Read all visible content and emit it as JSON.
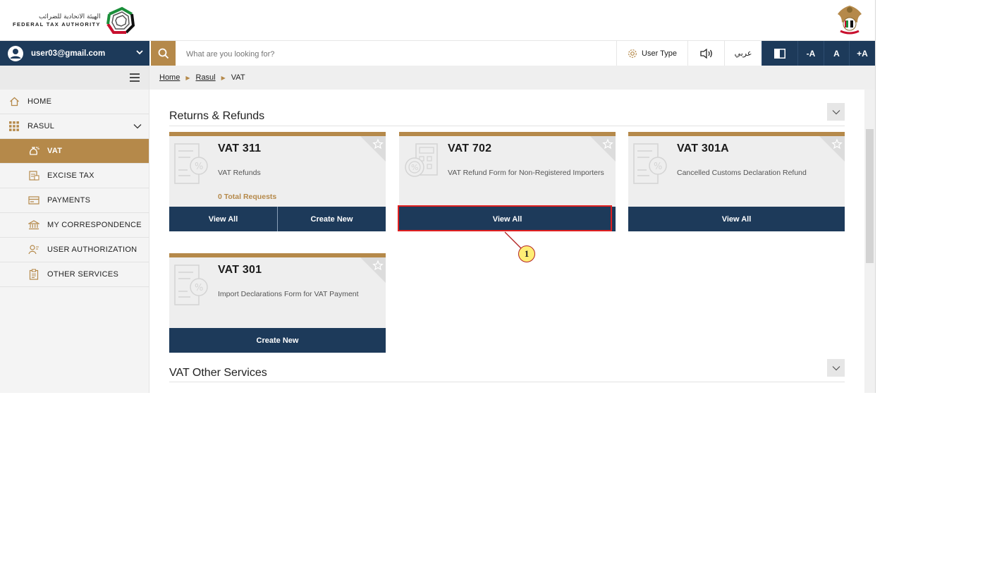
{
  "branding": {
    "arabic_name": "الهيئة الاتحادية للضرائب",
    "english_name": "FEDERAL TAX AUTHORITY",
    "brand_color": "#b5894a",
    "navy_color": "#1d3a5a"
  },
  "topnav": {
    "user_email": "user03@gmail.com",
    "search_placeholder": "What are you looking for?",
    "user_type_label": "User Type",
    "language_label": "عربي",
    "font_decrease": "-A",
    "font_reset": "A",
    "font_increase": "+A"
  },
  "sidebar": {
    "items": [
      {
        "label": "HOME",
        "icon": "home-icon"
      },
      {
        "label": "RASUL",
        "icon": "grid-icon"
      },
      {
        "label": "VAT",
        "icon": "money-bag-icon",
        "active": true
      },
      {
        "label": "EXCISE TAX",
        "icon": "excise-icon"
      },
      {
        "label": "PAYMENTS",
        "icon": "card-icon"
      },
      {
        "label": "MY CORRESPONDENCE",
        "icon": "bank-icon"
      },
      {
        "label": "USER AUTHORIZATION",
        "icon": "user-key-icon"
      },
      {
        "label": "OTHER SERVICES",
        "icon": "clipboard-icon"
      }
    ]
  },
  "breadcrumb": {
    "items": [
      "Home",
      "Rasul",
      "VAT"
    ]
  },
  "sections": {
    "returns_title": "Returns & Refunds",
    "other_title": "VAT Other Services"
  },
  "cards": [
    {
      "title": "VAT 311",
      "desc": "VAT Refunds",
      "count": "0 Total Requests",
      "buttons": [
        "View All",
        "Create New"
      ]
    },
    {
      "title": "VAT 702",
      "desc": "VAT Refund Form for Non-Registered Importers",
      "buttons": [
        "View All"
      ]
    },
    {
      "title": "VAT 301A",
      "desc": "Cancelled Customs Declaration Refund",
      "buttons": [
        "View All"
      ]
    },
    {
      "title": "VAT 301",
      "desc": "Import Declarations Form for VAT Payment",
      "buttons": [
        "Create New"
      ]
    }
  ],
  "callout": {
    "number": "1",
    "color": "#e02020"
  }
}
